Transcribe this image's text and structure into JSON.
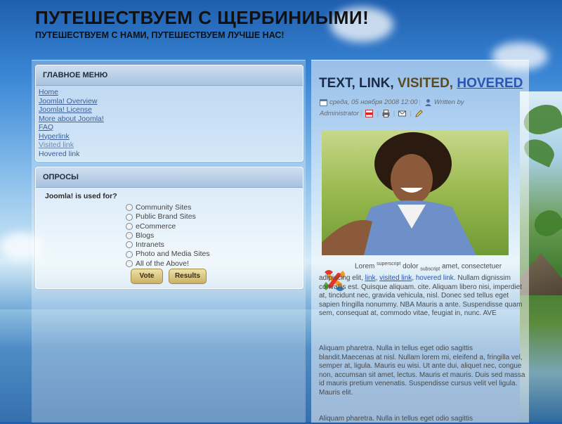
{
  "site": {
    "title": "ПУТЕШЕСТВУЕМ С ЩЕРБИНИЫМИ!",
    "subtitle": "ПУТЕШЕСТВУЕМ С НАМИ, ПУТЕШЕСТВУЕМ ЛУЧШЕ НАС!"
  },
  "main_menu": {
    "header": "ГЛАВНОЕ МЕНЮ",
    "items": [
      "Home",
      "Joomla! Overview",
      "Joomla! License",
      "More about Joomla!",
      "FAQ",
      "Hyperlink",
      "Visited link",
      "Hovered link"
    ]
  },
  "polls": {
    "header": "ОПРОСЫ",
    "question": "Joomla! is used for?",
    "options": [
      "Community Sites",
      "Public Brand Sites",
      "eCommerce",
      "Blogs",
      "Intranets",
      "Photo and Media Sites",
      "All of the Above!"
    ],
    "vote_label": "Vote",
    "results_label": "Results"
  },
  "article": {
    "title": {
      "text": "TEXT,",
      "link": "LINK,",
      "visited": "VISITED,",
      "hovered": "HOVERED"
    },
    "meta": {
      "date": "среда, 05 ноября 2008 12:00",
      "author_prefix": "Written by",
      "author": "Administrator"
    },
    "p1": {
      "lorem": "Lorem",
      "sup": "superscript",
      "dolor": "dolor",
      "sub": "subscript",
      "amet": "amet, consectetuer adipiscing elit,",
      "link": "link",
      "visited": "visited link",
      "hovered": "hovered link",
      "rest": ". Nullam dignissim convallis est. Quisque aliquam. cite. Aliquam libero nisi, imperdiet at, tincidunt nec, gravida vehicula, nisl. Donec sed tellus eget sapien fringilla nonummy. NBA Mauris a ante. Suspendisse quam sem, consequat at, commodo vitae, feugiat in, nunc. AVE"
    },
    "p2": "Aliquam pharetra. Nulla in tellus eget odio sagittis blandit.Maecenas at nisl. Nullam lorem mi, eleifend a, fringilla vel, semper at, ligula. Mauris eu wisi. Ut ante dui, aliquet nec, congue non, accumsan sit amet, lectus. Mauris et mauris. Duis sed massa id mauris pretium venenatis. Suspendisse cursus velit vel ligula. Mauris elit.",
    "p3": "Aliquam pharetra. Nulla in tellus eget odio sagittis"
  },
  "colors": {
    "accent_link": "#2a55b5",
    "button_gold": "#c9b067",
    "panel_header": "#a8c2df"
  }
}
